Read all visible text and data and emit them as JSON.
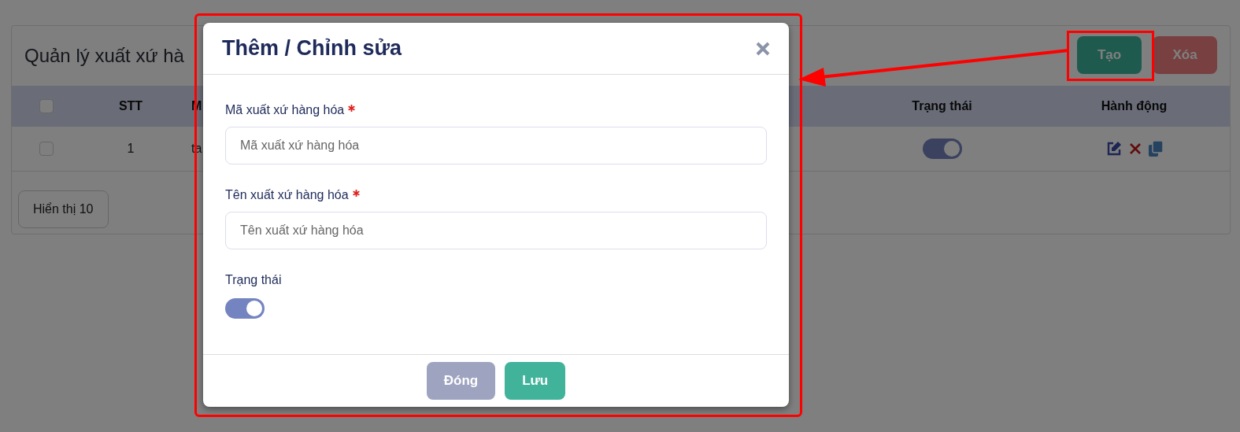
{
  "page": {
    "title": "Quản lý xuất xứ hà",
    "buttons": [
      {
        "label": "Tạo",
        "kind": "create"
      },
      {
        "label": "Xóa",
        "kind": "delete"
      }
    ]
  },
  "table": {
    "select_all": {
      "checked": false
    },
    "columns": [
      "STT",
      "M",
      "Trạng thái",
      "Hành động"
    ],
    "rows": [
      {
        "checked": false,
        "stt": "1",
        "column_3": "ta",
        "active": true
      }
    ]
  },
  "page_size": "Hiển thị 10",
  "modal": {
    "title": "Thêm / Chỉnh sửa",
    "fields": [
      {
        "label": "Mã xuất xứ hàng hóa",
        "required": true,
        "placeholder": "Mã xuất xứ hàng hóa"
      },
      {
        "label": "Tên xuất xứ hàng hóa",
        "required": true,
        "placeholder": "Tên xuất xứ hàng hóa"
      }
    ],
    "status": {
      "label": "Trạng thái",
      "on": true
    },
    "buttons": [
      {
        "label": "Đóng",
        "kind": "close"
      },
      {
        "label": "Lưu",
        "kind": "save"
      }
    ]
  }
}
